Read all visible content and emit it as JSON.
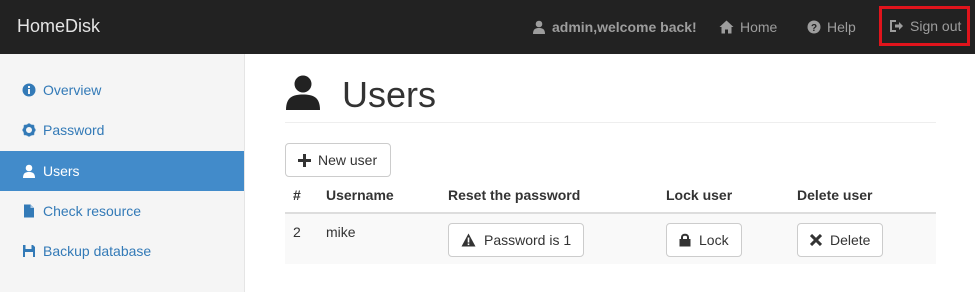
{
  "navbar": {
    "brand": "HomeDisk",
    "welcome": "admin,welcome back!",
    "home_label": "Home",
    "help_label": "Help",
    "signout_label": "Sign out"
  },
  "sidebar": {
    "items": [
      {
        "label": "Overview",
        "icon": "info-icon",
        "active": false
      },
      {
        "label": "Password",
        "icon": "gear-icon",
        "active": false
      },
      {
        "label": "Users",
        "icon": "user-icon",
        "active": true
      },
      {
        "label": "Check resource",
        "icon": "file-icon",
        "active": false
      },
      {
        "label": "Backup database",
        "icon": "floppy-icon",
        "active": false
      }
    ]
  },
  "main": {
    "title": "Users",
    "new_user_label": "New user",
    "table": {
      "headers": [
        "#",
        "Username",
        "Reset the password",
        "Lock user",
        "Delete user"
      ],
      "rows": [
        {
          "id": "2",
          "username": "mike",
          "reset_label": "Password is 1",
          "lock_label": "Lock",
          "delete_label": "Delete"
        }
      ]
    }
  },
  "colors": {
    "navbar_bg": "#222222",
    "sidebar_active": "#428bca",
    "link": "#337ab7",
    "highlight_border": "#e0141c"
  }
}
